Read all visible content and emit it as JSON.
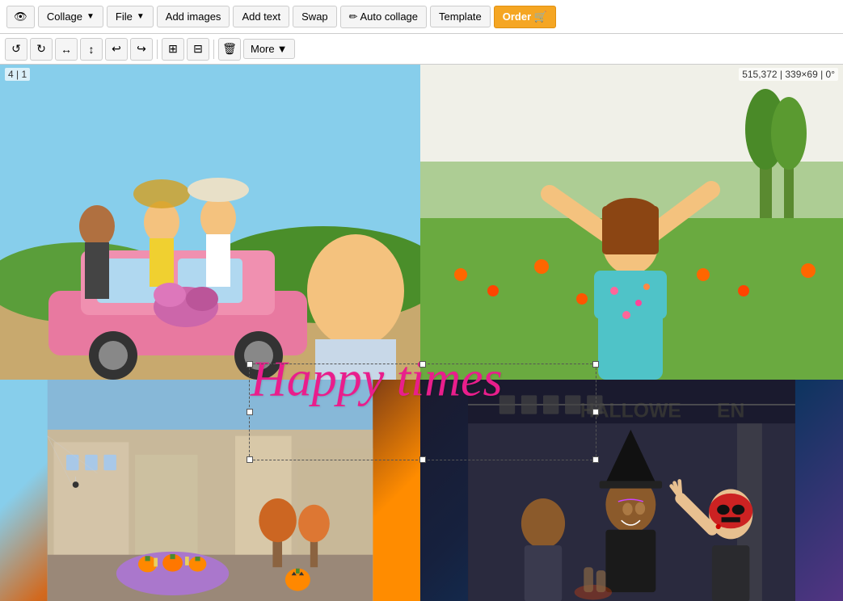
{
  "topToolbar": {
    "eyeLabel": "👁",
    "collageLabel": "Collage",
    "fileLabel": "File",
    "addImagesLabel": "Add images",
    "addTextLabel": "Add text",
    "swapLabel": "Swap",
    "autoCollageLabel": "✏ Auto collage",
    "templateLabel": "Template",
    "orderLabel": "Order 🛒"
  },
  "secondToolbar": {
    "moreLabel": "More",
    "icons": [
      "↺",
      "↻",
      "↺",
      "↻",
      "↩",
      "↪",
      "▭",
      "▭",
      "🗑"
    ]
  },
  "canvas": {
    "statusTopLeft": "4 | 1",
    "statusTopRight": "515,372 | 339×69 | 0°"
  },
  "overlayText": {
    "content": "Happy times"
  }
}
